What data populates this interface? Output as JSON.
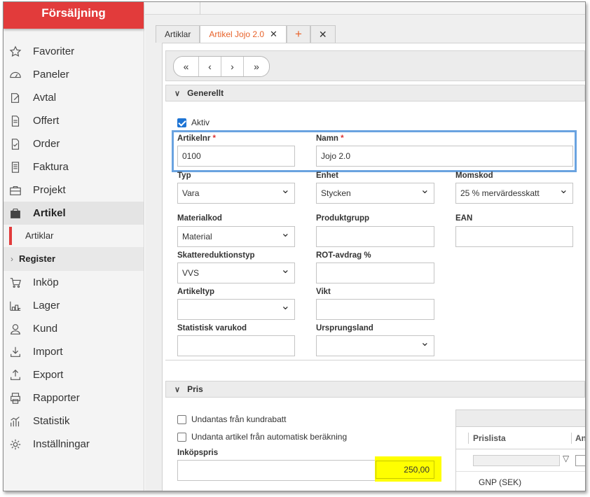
{
  "app": {
    "module_title": "Försäljning"
  },
  "colors": {
    "brand": "#e23b3b",
    "accent": "#e8622a",
    "highlight": "#6aa3e0",
    "checkbox": "#1e74d4"
  },
  "sidebar": {
    "items": [
      {
        "label": "Favoriter",
        "icon": "star-icon"
      },
      {
        "label": "Paneler",
        "icon": "gauge-icon"
      },
      {
        "label": "Avtal",
        "icon": "contract-icon"
      },
      {
        "label": "Offert",
        "icon": "document-icon"
      },
      {
        "label": "Order",
        "icon": "order-icon"
      },
      {
        "label": "Faktura",
        "icon": "invoice-icon"
      },
      {
        "label": "Projekt",
        "icon": "briefcase-icon"
      },
      {
        "label": "Artikel",
        "icon": "box-icon"
      },
      {
        "label": "Inköp",
        "icon": "cart-icon"
      },
      {
        "label": "Lager",
        "icon": "warehouse-icon"
      },
      {
        "label": "Kund",
        "icon": "user-icon"
      },
      {
        "label": "Import",
        "icon": "import-icon"
      },
      {
        "label": "Export",
        "icon": "export-icon"
      },
      {
        "label": "Rapporter",
        "icon": "printer-icon"
      },
      {
        "label": "Statistik",
        "icon": "stats-icon"
      },
      {
        "label": "Inställningar",
        "icon": "gear-icon"
      }
    ],
    "sub_artiklar": "Artiklar",
    "sub_register": "Register"
  },
  "tabs": [
    {
      "label": "Artiklar"
    },
    {
      "label": "Artikel Jojo 2.0",
      "close": "✕"
    },
    {
      "label": "+"
    },
    {
      "label": "✕"
    }
  ],
  "pager": {
    "first": "«",
    "prev": "‹",
    "next": "›",
    "last": "»"
  },
  "general": {
    "section_title": "Generellt",
    "aktiv_label": "Aktiv",
    "aktiv_checked": true,
    "artikelnr_label": "Artikelnr",
    "artikelnr_value": "0100",
    "namn_label": "Namn",
    "namn_value": "Jojo 2.0",
    "required_mark": "*",
    "typ_label": "Typ",
    "typ_value": "Vara",
    "enhet_label": "Enhet",
    "enhet_value": "Stycken",
    "momskod_label": "Momskod",
    "momskod_value": "25 % mervärdesskatt",
    "materialkod_label": "Materialkod",
    "materialkod_value": "Material",
    "produktgrupp_label": "Produktgrupp",
    "produktgrupp_value": "",
    "ean_label": "EAN",
    "ean_value": "",
    "skattered_label": "Skattereduktionstyp",
    "skattered_value": "VVS",
    "rot_label": "ROT-avdrag %",
    "rot_value": "",
    "artikeltyp_label": "Artikeltyp",
    "artikeltyp_value": "",
    "vikt_label": "Vikt",
    "vikt_value": "",
    "statistisk_label": "Statistisk varukod",
    "statistisk_value": "",
    "ursprung_label": "Ursprungsland",
    "ursprung_value": ""
  },
  "pris": {
    "section_title": "Pris",
    "undantas_label": "Undantas från kundrabatt",
    "undanta_auto_label": "Undanta artikel från automatisk beräkning",
    "inkopspris_label": "Inköpspris",
    "inkopspris_value": "250,00",
    "grid": {
      "col_prislista": "Prislista",
      "col_antal": "Anta",
      "rows": [
        "GNP (SEK)"
      ]
    }
  }
}
